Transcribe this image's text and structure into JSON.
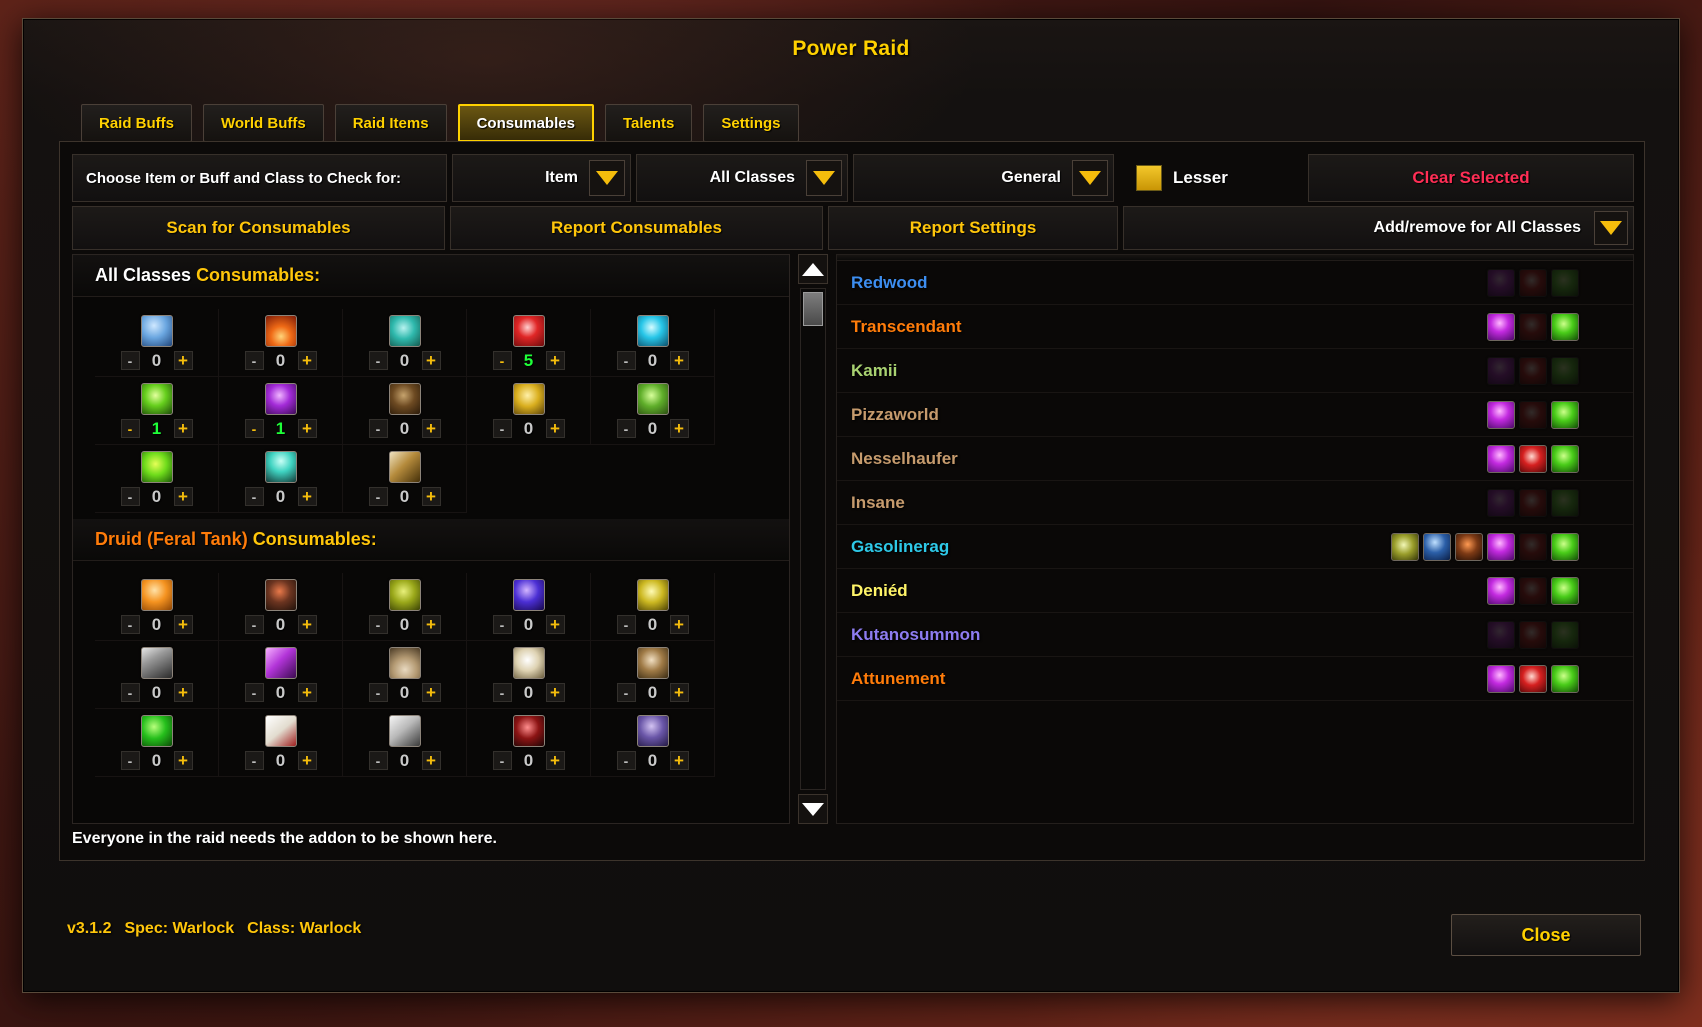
{
  "window": {
    "title": "Power Raid",
    "close_label": "Close"
  },
  "tabs": [
    {
      "label": "Raid Buffs",
      "active": false
    },
    {
      "label": "World Buffs",
      "active": false
    },
    {
      "label": "Raid Items",
      "active": false
    },
    {
      "label": "Consumables",
      "active": true
    },
    {
      "label": "Talents",
      "active": false
    },
    {
      "label": "Settings",
      "active": false
    }
  ],
  "choose_bar": {
    "label": "Choose Item or Buff and Class to Check for:",
    "type_dropdown": "Item",
    "class_dropdown": "All Classes",
    "category_dropdown": "General",
    "lesser_label": "Lesser",
    "lesser_color": "#f0c419",
    "clear_label": "Clear Selected",
    "clear_color": "#ff2e55"
  },
  "action_bar": {
    "scan_label": "Scan for Consumables",
    "report_label": "Report Consumables",
    "report_settings_label": "Report Settings",
    "add_remove_label": "Add/remove for All Classes"
  },
  "left_panel": {
    "sections": [
      {
        "title_prefix": "All Classes ",
        "title_suffix": "Consumables:",
        "prefix_color": "#ffffff",
        "rows": [
          [
            {
              "icon": "ic-bluevial",
              "name": "blue-vial-icon",
              "count": "0"
            },
            {
              "icon": "ic-fire",
              "name": "fire-elixir-icon",
              "count": "0"
            },
            {
              "icon": "ic-tealflask",
              "name": "teal-flask-icon",
              "count": "0"
            },
            {
              "icon": "ic-redelixir",
              "name": "red-elixir-icon",
              "count": "5"
            },
            {
              "icon": "ic-cyanflask",
              "name": "cyan-flask-icon",
              "count": "0"
            }
          ],
          [
            {
              "icon": "ic-greenflask",
              "name": "green-flask-icon",
              "count": "1"
            },
            {
              "icon": "ic-purpflask",
              "name": "purple-flask-icon",
              "count": "1"
            },
            {
              "icon": "ic-keg",
              "name": "keg-icon",
              "count": "0"
            },
            {
              "icon": "ic-goldvial",
              "name": "gold-vial-icon",
              "count": "0"
            },
            {
              "icon": "ic-greenherb",
              "name": "green-herb-icon",
              "count": "0"
            }
          ],
          [
            {
              "icon": "ic-greenrune",
              "name": "green-rune-icon",
              "count": "0"
            },
            {
              "icon": "ic-bowl",
              "name": "teal-bowl-icon",
              "count": "0"
            },
            {
              "icon": "ic-wand",
              "name": "wand-icon",
              "count": "0"
            }
          ]
        ]
      },
      {
        "title_prefix": "Druid (Feral Tank) ",
        "title_suffix": "Consumables:",
        "prefix_color": "#ff7c0a",
        "rows": [
          [
            {
              "icon": "ic-orange",
              "name": "orange-fruit-icon",
              "count": "0"
            },
            {
              "icon": "ic-rock",
              "name": "rock-icon",
              "count": "0"
            },
            {
              "icon": "ic-olive",
              "name": "olive-potion-icon",
              "count": "0"
            },
            {
              "icon": "ic-bluepot",
              "name": "blue-potion-icon",
              "count": "0"
            },
            {
              "icon": "ic-yellowpot",
              "name": "yellow-potion-icon",
              "count": "0"
            }
          ],
          [
            {
              "icon": "ic-canister",
              "name": "canister-icon",
              "count": "0"
            },
            {
              "icon": "ic-purpspike",
              "name": "purple-spike-icon",
              "count": "0"
            },
            {
              "icon": "ic-sand",
              "name": "sand-pile-icon",
              "count": "0"
            },
            {
              "icon": "ic-whitefin",
              "name": "white-fin-icon",
              "count": "0"
            },
            {
              "icon": "ic-brownfin",
              "name": "brown-fin-icon",
              "count": "0"
            }
          ],
          [
            {
              "icon": "ic-greenleaf",
              "name": "green-leaf-icon",
              "count": "0"
            },
            {
              "icon": "ic-bandage",
              "name": "bandage-icon",
              "count": "0"
            },
            {
              "icon": "ic-spike",
              "name": "spike-icon",
              "count": "0"
            },
            {
              "icon": "ic-darkred",
              "name": "dark-red-icon",
              "count": "0"
            },
            {
              "icon": "ic-purpjar",
              "name": "purple-jar-icon",
              "count": "0"
            }
          ]
        ]
      }
    ],
    "stepper": {
      "minus": "-",
      "plus": "+"
    }
  },
  "right_panel": {
    "players": [
      {
        "name": "Redwood",
        "color": "#3d8ef0",
        "extra": [],
        "icons": [
          {
            "name": "flask-icon",
            "art": "ic-flaskpurp",
            "has": false
          },
          {
            "name": "red-elixir-icon",
            "art": "ic-elixred",
            "has": false
          },
          {
            "name": "green-elixir-icon",
            "art": "ic-elixgreen",
            "has": false
          }
        ]
      },
      {
        "name": "Transcendant",
        "color": "#ff7c0a",
        "extra": [],
        "icons": [
          {
            "name": "flask-icon",
            "art": "ic-flaskpurp",
            "has": true
          },
          {
            "name": "red-elixir-icon",
            "art": "ic-elixred",
            "has": false
          },
          {
            "name": "green-elixir-icon",
            "art": "ic-elixgreen",
            "has": true
          }
        ]
      },
      {
        "name": "Kamii",
        "color": "#a9d271",
        "extra": [],
        "icons": [
          {
            "name": "flask-icon",
            "art": "ic-flaskpurp",
            "has": false
          },
          {
            "name": "red-elixir-icon",
            "art": "ic-elixred",
            "has": false
          },
          {
            "name": "green-elixir-icon",
            "art": "ic-elixgreen",
            "has": false
          }
        ]
      },
      {
        "name": "Pizzaworld",
        "color": "#c69b6d",
        "extra": [],
        "icons": [
          {
            "name": "flask-icon",
            "art": "ic-flaskpurp",
            "has": true
          },
          {
            "name": "red-elixir-icon",
            "art": "ic-elixred",
            "has": false
          },
          {
            "name": "green-elixir-icon",
            "art": "ic-elixgreen",
            "has": true
          }
        ]
      },
      {
        "name": "Nesselhaufer",
        "color": "#c69b6d",
        "extra": [],
        "icons": [
          {
            "name": "flask-icon",
            "art": "ic-flaskpurp",
            "has": true
          },
          {
            "name": "red-elixir-icon",
            "art": "ic-elixred",
            "has": true
          },
          {
            "name": "green-elixir-icon",
            "art": "ic-elixgreen",
            "has": true
          }
        ]
      },
      {
        "name": "Insane",
        "color": "#c69b6d",
        "extra": [],
        "icons": [
          {
            "name": "flask-icon",
            "art": "ic-flaskpurp",
            "has": false
          },
          {
            "name": "red-elixir-icon",
            "art": "ic-elixred",
            "has": false
          },
          {
            "name": "green-elixir-icon",
            "art": "ic-elixgreen",
            "has": false
          }
        ]
      },
      {
        "name": "Gasolinerag",
        "color": "#2ec9e8",
        "extra": [
          {
            "name": "eye-flask-icon",
            "art": "ic-eyeflask",
            "has": true
          },
          {
            "name": "navy-potion-icon",
            "art": "ic-navypot",
            "has": true
          },
          {
            "name": "meat-icon",
            "art": "ic-meat",
            "has": true
          }
        ],
        "icons": [
          {
            "name": "flask-icon",
            "art": "ic-flaskpurp",
            "has": true
          },
          {
            "name": "red-elixir-icon",
            "art": "ic-elixred",
            "has": false
          },
          {
            "name": "green-elixir-icon",
            "art": "ic-elixgreen",
            "has": true
          }
        ]
      },
      {
        "name": "Deniéd",
        "color": "#fff468",
        "extra": [],
        "icons": [
          {
            "name": "flask-icon",
            "art": "ic-flaskpurp",
            "has": true
          },
          {
            "name": "red-elixir-icon",
            "art": "ic-elixred",
            "has": false
          },
          {
            "name": "green-elixir-icon",
            "art": "ic-elixgreen",
            "has": true
          }
        ]
      },
      {
        "name": "Kutanosummon",
        "color": "#8e7cf0",
        "extra": [],
        "icons": [
          {
            "name": "flask-icon",
            "art": "ic-flaskpurp",
            "has": false
          },
          {
            "name": "red-elixir-icon",
            "art": "ic-elixred",
            "has": false
          },
          {
            "name": "green-elixir-icon",
            "art": "ic-elixgreen",
            "has": false
          }
        ]
      },
      {
        "name": "Attunement",
        "color": "#ff7c0a",
        "extra": [],
        "icons": [
          {
            "name": "flask-icon",
            "art": "ic-flaskpurp",
            "has": true
          },
          {
            "name": "red-elixir-icon",
            "art": "ic-elixred",
            "has": true
          },
          {
            "name": "green-elixir-icon",
            "art": "ic-elixgreen",
            "has": true
          }
        ]
      }
    ]
  },
  "footer_note": "Everyone in the raid needs the addon to be shown here.",
  "status": {
    "version": "v3.1.2",
    "spec": "Spec: Warlock",
    "class": "Class: Warlock"
  }
}
